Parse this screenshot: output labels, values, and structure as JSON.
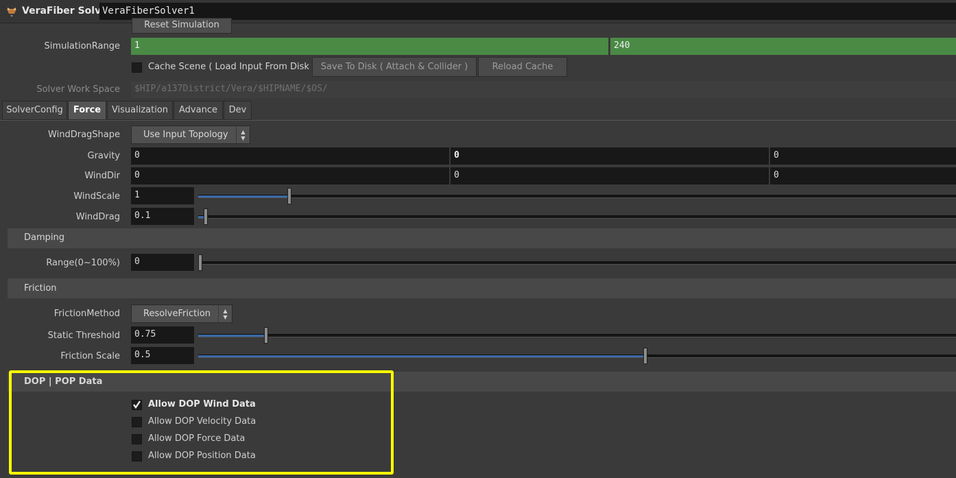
{
  "header": {
    "node_type": "VeraFiber Solver",
    "node_name": "VeraFiberSolver1",
    "icon": "node-type-icon"
  },
  "top": {
    "reset_label": "Reset Simulation",
    "sim_range_label": "SimulationRange",
    "sim_range_start": "1",
    "sim_range_end": "240",
    "cache_label": "Cache Scene ( Load Input From Disk )",
    "save_label": "Save To Disk ( Attach & Collider )",
    "reload_label": "Reload Cache",
    "workspace_label": "Solver Work Space",
    "workspace_value": "$HIP/a137District/Vera/$HIPNAME/$OS/"
  },
  "tabs": [
    {
      "label": "SolverConfig"
    },
    {
      "label": "Force"
    },
    {
      "label": "Visualization"
    },
    {
      "label": "Advance"
    },
    {
      "label": "Dev"
    }
  ],
  "force": {
    "wind_drag_shape_label": "WindDragShape",
    "wind_drag_shape_value": "Use Input Topology",
    "gravity_label": "Gravity",
    "gravity": [
      "0",
      "0",
      "0"
    ],
    "wind_dir_label": "WindDir",
    "wind_dir": [
      "0",
      "0",
      "0"
    ],
    "wind_scale_label": "WindScale",
    "wind_scale": "1",
    "wind_scale_slider": 0.12,
    "wind_drag_label": "WindDrag",
    "wind_drag": "0.1",
    "wind_drag_slider": 0.01
  },
  "damping": {
    "title": "Damping",
    "range_label": "Range(0~100%)",
    "range_value": "0",
    "range_slider": 0.0
  },
  "friction": {
    "title": "Friction",
    "method_label": "FrictionMethod",
    "method_value": "ResolveFriction",
    "static_label": "Static Threshold",
    "static_value": "0.75",
    "static_slider": 0.09,
    "scale_label": "Friction Scale",
    "scale_value": "0.5",
    "scale_slider": 0.59
  },
  "dop": {
    "title": "DOP | POP Data",
    "items": [
      {
        "label": "Allow DOP Wind Data",
        "checked": true
      },
      {
        "label": "Allow DOP Velocity Data",
        "checked": false
      },
      {
        "label": "Allow DOP Force Data",
        "checked": false
      },
      {
        "label": "Allow DOP Position Data",
        "checked": false
      }
    ],
    "highlight_color": "#ffff00"
  },
  "colors": {
    "range_green": "#4a8a45",
    "slider_blue": "#3b6aa8"
  }
}
